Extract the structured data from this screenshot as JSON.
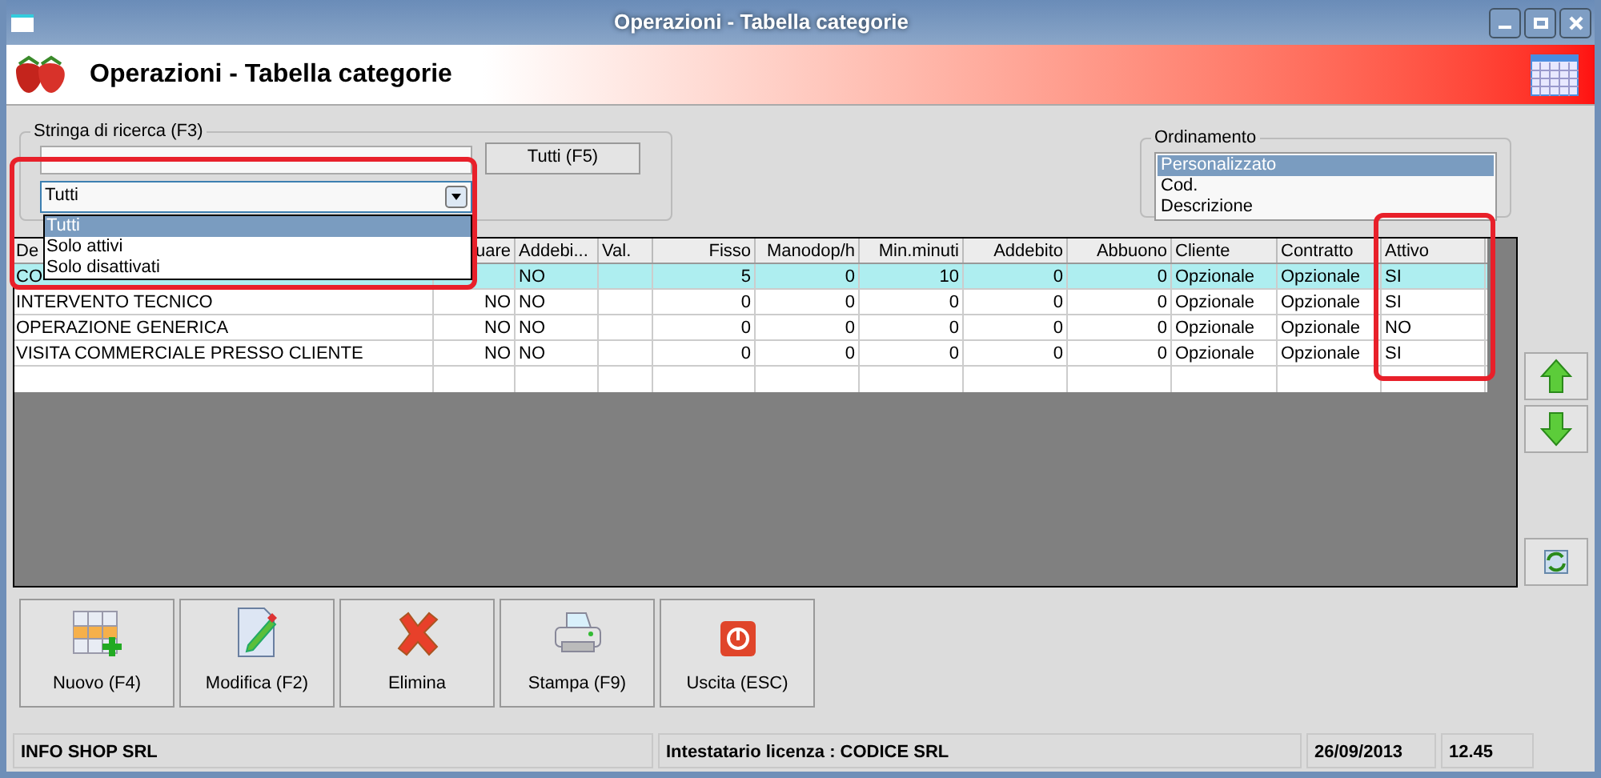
{
  "window": {
    "title": "Operazioni - Tabella categorie"
  },
  "header": {
    "title": "Operazioni - Tabella categorie"
  },
  "search": {
    "label": "Stringa di ricerca (F3)",
    "button": "Tutti (F5)",
    "filter": {
      "value": "Tutti",
      "expanded": true,
      "options": [
        {
          "label": "Tutti",
          "selected": true
        },
        {
          "label": "Solo attivi",
          "selected": false
        },
        {
          "label": "Solo disattivati",
          "selected": false
        }
      ]
    }
  },
  "sort": {
    "label": "Ordinamento",
    "items": [
      {
        "label": "Personalizzato",
        "selected": true
      },
      {
        "label": "Cod.",
        "selected": false
      },
      {
        "label": "Descrizione",
        "selected": false
      }
    ]
  },
  "table": {
    "columns": [
      {
        "label": "De",
        "kind": "text"
      },
      {
        "label": "uare",
        "kind": "flag"
      },
      {
        "label": "Addebi...",
        "kind": "text"
      },
      {
        "label": "Val.",
        "kind": "text"
      },
      {
        "label": "Fisso",
        "kind": "number"
      },
      {
        "label": "Manodop/h",
        "kind": "number"
      },
      {
        "label": "Min.minuti",
        "kind": "number"
      },
      {
        "label": "Addebito",
        "kind": "number"
      },
      {
        "label": "Abbuono",
        "kind": "number"
      },
      {
        "label": "Cliente",
        "kind": "text"
      },
      {
        "label": "Contratto",
        "kind": "text"
      },
      {
        "label": "Attivo",
        "kind": "text"
      }
    ],
    "rows": [
      {
        "selected": true,
        "cells": [
          "CO",
          "",
          "NO",
          "",
          "5",
          "0",
          "10",
          "0",
          "0",
          "Opzionale",
          "Opzionale",
          "SI"
        ]
      },
      {
        "selected": false,
        "cells": [
          "INTERVENTO TECNICO",
          "NO",
          "NO",
          "",
          "0",
          "0",
          "0",
          "0",
          "0",
          "Opzionale",
          "Opzionale",
          "SI"
        ]
      },
      {
        "selected": false,
        "cells": [
          "OPERAZIONE GENERICA",
          "NO",
          "NO",
          "",
          "0",
          "0",
          "0",
          "0",
          "0",
          "Opzionale",
          "Opzionale",
          "NO"
        ]
      },
      {
        "selected": false,
        "cells": [
          "VISITA COMMERCIALE PRESSO CLIENTE",
          "NO",
          "NO",
          "",
          "0",
          "0",
          "0",
          "0",
          "0",
          "Opzionale",
          "Opzionale",
          "SI"
        ]
      }
    ]
  },
  "actions": [
    {
      "label": "Nuovo (F4)",
      "kind": "new"
    },
    {
      "label": "Modifica (F2)",
      "kind": "edit"
    },
    {
      "label": "Elimina",
      "kind": "delete"
    },
    {
      "label": "Stampa (F9)",
      "kind": "print"
    },
    {
      "label": "Uscita (ESC)",
      "kind": "exit"
    }
  ],
  "status_bar": [
    "INFO SHOP SRL",
    "Intestatario licenza : CODICE SRL",
    "26/09/2013",
    "12.45"
  ]
}
